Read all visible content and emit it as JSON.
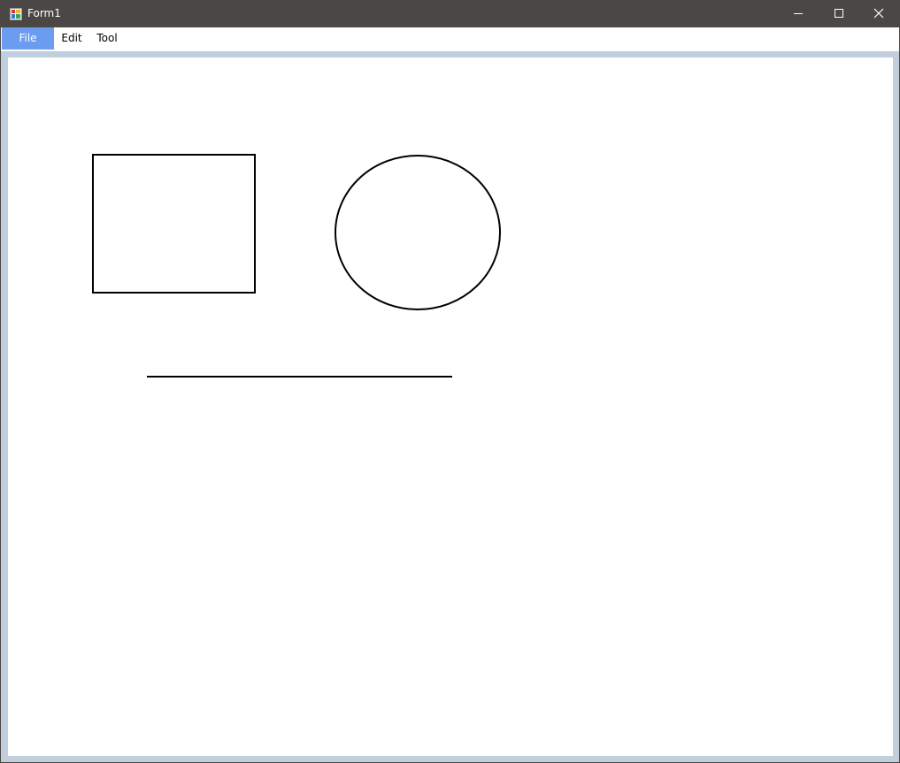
{
  "window": {
    "title": "Form1",
    "icon": "form-app-icon",
    "controls": {
      "minimize": "minimize-icon",
      "maximize": "maximize-icon",
      "close": "close-icon"
    }
  },
  "menu": {
    "items": [
      {
        "label": "File",
        "selected": true
      },
      {
        "label": "Edit",
        "selected": false
      },
      {
        "label": "Tool",
        "selected": false
      }
    ]
  },
  "canvas": {
    "shapes": [
      "rectangle",
      "ellipse",
      "line"
    ],
    "stroke_color": "#000000"
  },
  "colors": {
    "titlebar": "#4a4744",
    "menu_highlight": "#6b9cf0",
    "client_background": "#c0cedd",
    "canvas_background": "#ffffff"
  }
}
